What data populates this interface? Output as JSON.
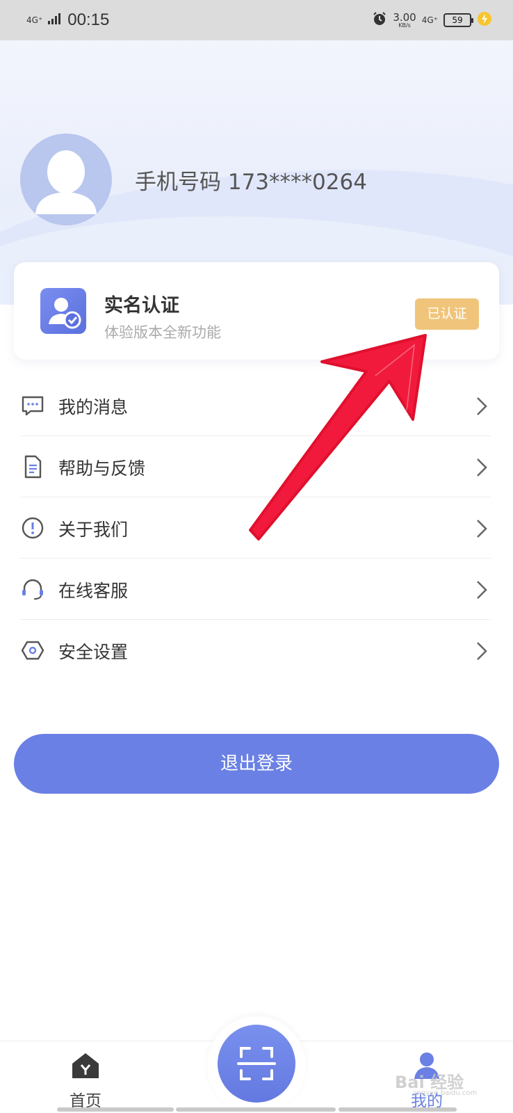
{
  "status_bar": {
    "time": "00:15",
    "network_left": "4G⁺",
    "speed_value": "3.00",
    "speed_unit": "KB/s",
    "network_right": "4G⁺",
    "battery_level": "59"
  },
  "profile": {
    "phone_label": "手机号码 173****0264"
  },
  "auth_card": {
    "title": "实名认证",
    "subtitle": "体验版本全新功能",
    "badge": "已认证"
  },
  "menu": [
    {
      "label": "我的消息",
      "icon": "message-icon"
    },
    {
      "label": "帮助与反馈",
      "icon": "document-icon"
    },
    {
      "label": "关于我们",
      "icon": "info-icon"
    },
    {
      "label": "在线客服",
      "icon": "headset-icon"
    },
    {
      "label": "安全设置",
      "icon": "settings-hex-icon"
    }
  ],
  "logout_label": "退出登录",
  "tab_bar": {
    "home_label": "首页",
    "mine_label": "我的",
    "active_color": "#6a80e4"
  },
  "watermark": {
    "text": "Bai 经验",
    "sub": "jingyan.baidu.com"
  },
  "colors": {
    "accent": "#6a80e4",
    "badge": "#f0c57b",
    "arrow": "#f21a3c"
  }
}
